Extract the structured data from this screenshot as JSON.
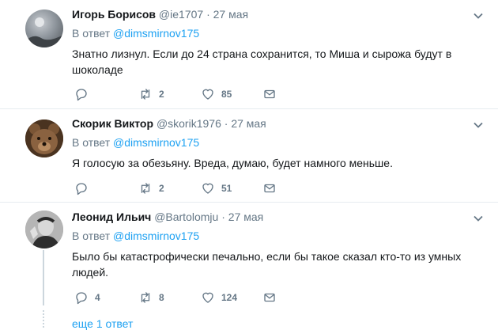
{
  "reply_prefix": "В ответ",
  "tweets": [
    {
      "name": "Игорь Борисов",
      "handle": "@ie1707",
      "date": "27 мая",
      "reply_to": "@dimsmirnov175",
      "text": "Знатно лизнул. Если до 24 страна сохранится, то Миша и сырожа будут в шоколаде",
      "replies": "",
      "retweets": "2",
      "likes": "85"
    },
    {
      "name": "Скорик Виктор",
      "handle": "@skorik1976",
      "date": "27 мая",
      "reply_to": "@dimsmirnov175",
      "text": "Я голосую за обезьяну. Вреда, думаю, будет намного меньше.",
      "replies": "",
      "retweets": "2",
      "likes": "51"
    },
    {
      "name": "Леонид Ильич",
      "handle": "@Bartolomju",
      "date": "27 мая",
      "reply_to": "@dimsmirnov175",
      "text": "Было бы катастрофически печально, если бы такое сказал кто-то из умных людей.",
      "replies": "4",
      "retweets": "8",
      "likes": "124"
    }
  ],
  "show_more": "еще 1 ответ",
  "colors": {
    "link": "#1da1f2",
    "secondary": "#657786",
    "divider": "#e6ecf0"
  }
}
